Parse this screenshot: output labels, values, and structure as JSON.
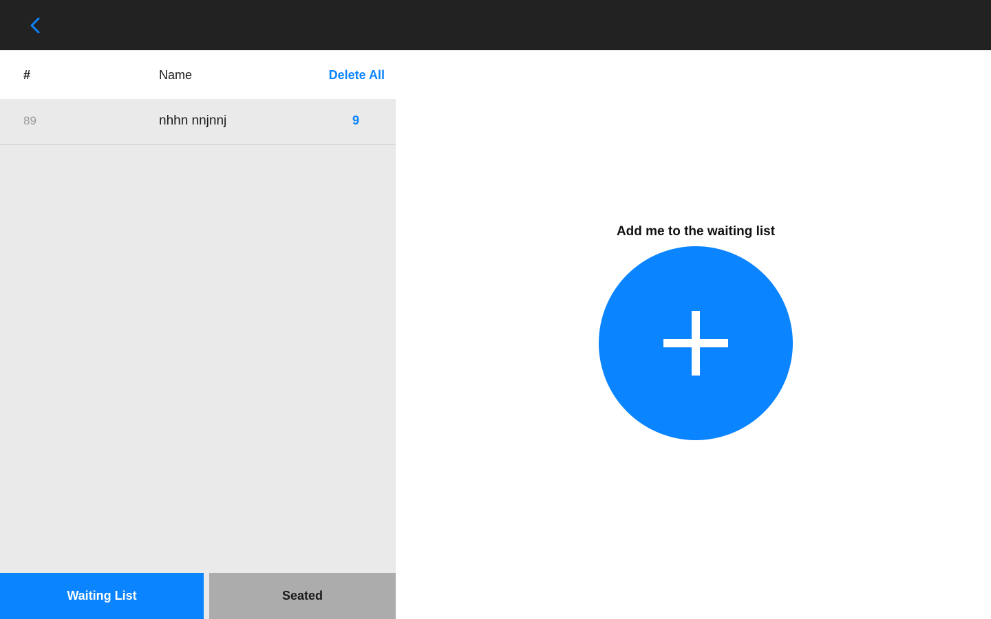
{
  "topbar": {
    "back_icon": "chevron-left-icon",
    "background": "#222222",
    "icon_color": "#0a84ff"
  },
  "list": {
    "header": {
      "number_label": "#",
      "name_label": "Name",
      "delete_all_label": "Delete All"
    },
    "rows": [
      {
        "number": "89",
        "name": "nhhn nnjnnj",
        "count": "9"
      }
    ]
  },
  "tabs": [
    {
      "label": "Waiting List",
      "active": true
    },
    {
      "label": "Seated",
      "active": false
    }
  ],
  "add": {
    "label": "Add me to the waiting list",
    "icon": "plus-icon"
  },
  "colors": {
    "accent": "#0a84ff",
    "panel_bg": "#eaeaea",
    "inactive_tab": "#acacac"
  }
}
